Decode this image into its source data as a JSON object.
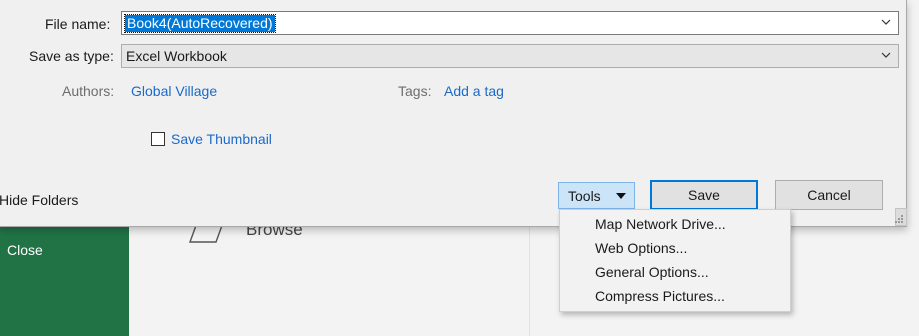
{
  "background": {
    "close_label": "Close",
    "browse_label": "Browse",
    "accent_color": "#217346"
  },
  "dialog": {
    "file_name_label": "File name:",
    "file_name_value": "Book4(AutoRecovered)",
    "save_as_type_label": "Save as type:",
    "save_as_type_value": "Excel Workbook",
    "authors_label": "Authors:",
    "authors_value": "Global Village",
    "tags_label": "Tags:",
    "tags_value": "Add a tag",
    "save_thumbnail_label": "Save Thumbnail",
    "save_thumbnail_checked": false,
    "hide_folders_label": "Hide Folders",
    "tools_label": "Tools",
    "save_label": "Save",
    "cancel_label": "Cancel"
  },
  "tools_menu": {
    "items": [
      {
        "label": "Map Network Drive..."
      },
      {
        "label": "Web Options..."
      },
      {
        "label": "General Options..."
      },
      {
        "label": "Compress Pictures..."
      }
    ]
  },
  "icons": {
    "combo_arrow": "chevron-down-icon",
    "tools_caret": "caret-down-icon",
    "browse": "folder-icon",
    "resize": "resize-grip-icon"
  }
}
